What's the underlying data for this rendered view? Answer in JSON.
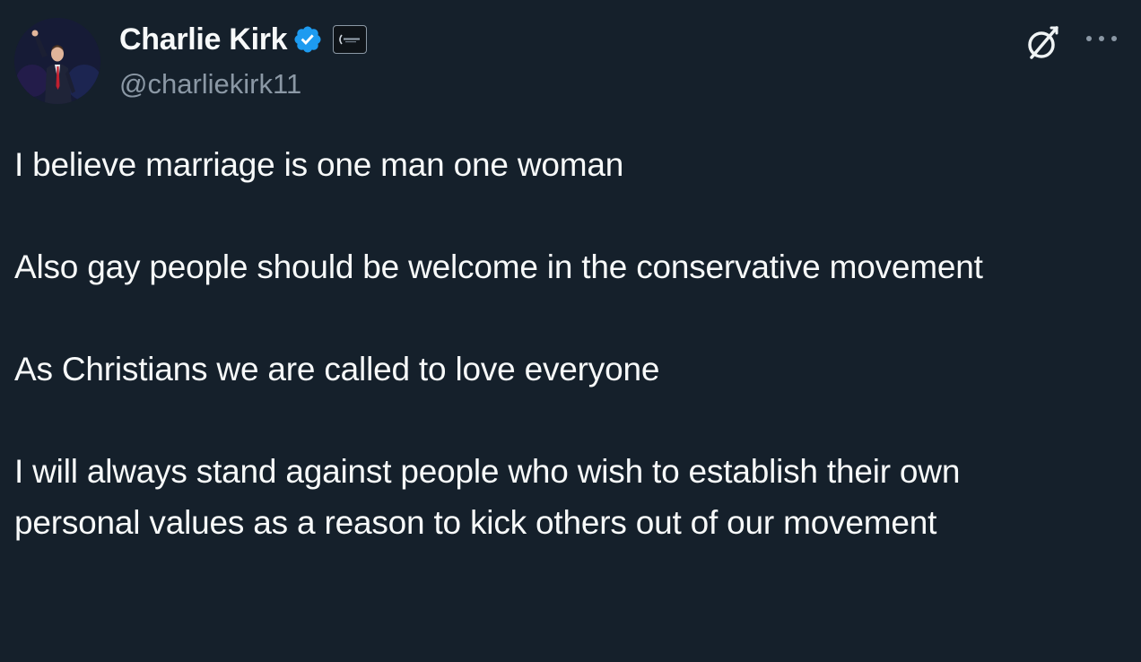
{
  "author": {
    "display_name": "Charlie Kirk",
    "handle": "@charliekirk11",
    "verified": true,
    "verified_icon": "verified-badge-icon",
    "verified_color": "#1d9bf0",
    "affiliate_icon": "organization-affiliate-badge-icon",
    "avatar": "profile-photo"
  },
  "header_actions": {
    "grok_icon": "grok-icon",
    "more_icon": "more-options-icon"
  },
  "tweet": {
    "paragraphs": [
      "I believe marriage is one man one woman",
      "Also gay people should be welcome in the conservative movement",
      "As Christians we are called to love everyone",
      "I will always stand against people who wish to establish their own personal values as a reason to kick others out of our movement"
    ]
  },
  "theme": {
    "background": "#15202b",
    "text_primary": "#f7f9f9",
    "text_secondary": "#8b98a5",
    "accent": "#1d9bf0"
  }
}
